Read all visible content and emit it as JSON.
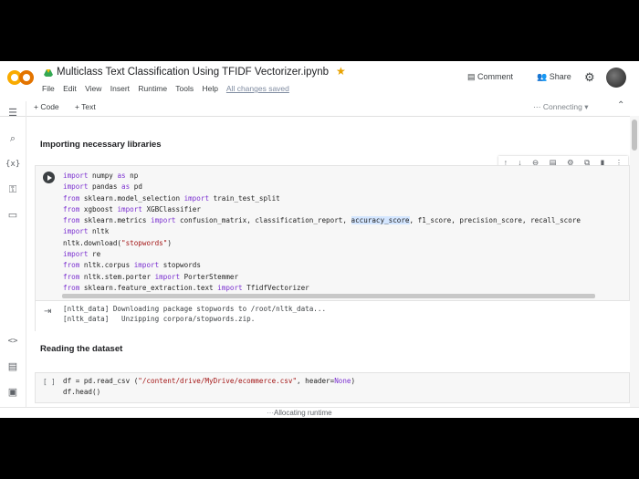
{
  "header": {
    "notebook_title": "Multiclass Text Classification Using TFIDF Vectorizer.ipynb",
    "menu": [
      "File",
      "Edit",
      "View",
      "Insert",
      "Runtime",
      "Tools",
      "Help"
    ],
    "save_status": "All changes saved",
    "comment_label": "Comment",
    "share_label": "Share"
  },
  "toolbar": {
    "add_code": "+ Code",
    "add_text": "+ Text",
    "connection_status": "Connecting"
  },
  "sections": {
    "imports_title": "Importing necessary libraries",
    "dataset_title": "Reading the dataset"
  },
  "cell1": {
    "lines": [
      "import numpy as np",
      "import pandas as pd",
      "from sklearn.model_selection import train_test_split",
      "from xgboost import XGBClassifier",
      "from sklearn.metrics import confusion_matrix, classification_report, accuracy_score, f1_score, precision_score, recall_score",
      "import nltk",
      "nltk.download(\"stopwords\")",
      "import re",
      "from nltk.corpus import stopwords",
      "from nltk.stem.porter import PorterStemmer",
      "from sklearn.feature_extraction.text import TfidfVectorizer"
    ],
    "output": [
      "[nltk_data] Downloading package stopwords to /root/nltk_data...",
      "[nltk_data]   Unzipping corpora/stopwords.zip."
    ]
  },
  "cell2": {
    "run_indicator": "[ ]",
    "lines": [
      "df = pd.read_csv (\"/content/drive/MyDrive/ecommerce.csv\", header=None)",
      "df.head()"
    ]
  },
  "status_bar": {
    "text": "Allocating runtime"
  },
  "colors": {
    "keyword": "#7b30d0",
    "string": "#a31515",
    "star": "#e8a200",
    "logo_orange": "#f9ab00"
  }
}
